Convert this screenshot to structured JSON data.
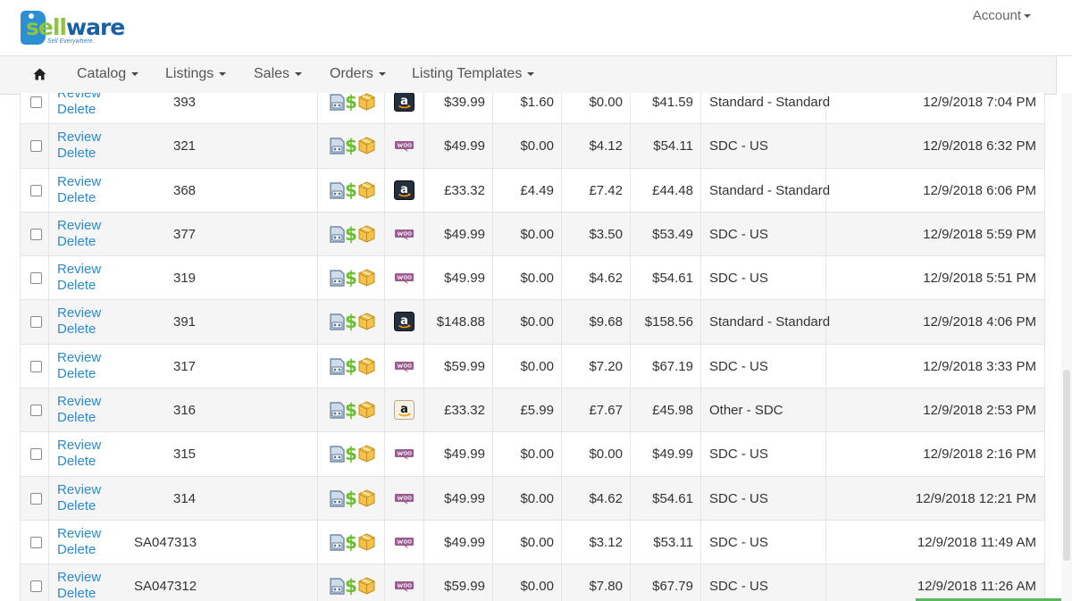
{
  "app": {
    "logo_text_a": "sell",
    "logo_text_b": "ware",
    "logo_tagline": "Sell Everywhere."
  },
  "header": {
    "account_label": "Account"
  },
  "nav": {
    "items": [
      {
        "label": "Catalog"
      },
      {
        "label": "Listings"
      },
      {
        "label": "Sales"
      },
      {
        "label": "Orders"
      },
      {
        "label": "Listing Templates"
      }
    ]
  },
  "row_actions": {
    "review_label": "Review",
    "delete_label": "Delete"
  },
  "orders": [
    {
      "sku": "393",
      "marketplace": "amazon-icon",
      "price": "$39.99",
      "fee": "$1.60",
      "tax": "$0.00",
      "total": "$41.59",
      "shipping": "Standard - Standard",
      "date": "12/9/2018 7:04 PM"
    },
    {
      "sku": "321",
      "marketplace": "woocommerce-icon",
      "price": "$49.99",
      "fee": "$0.00",
      "tax": "$4.12",
      "total": "$54.11",
      "shipping": "SDC - US",
      "date": "12/9/2018 6:32 PM"
    },
    {
      "sku": "368",
      "marketplace": "amazon-icon",
      "price": "£33.32",
      "fee": "£4.49",
      "tax": "£7.42",
      "total": "£44.48",
      "shipping": "Standard - Standard",
      "date": "12/9/2018 6:06 PM"
    },
    {
      "sku": "377",
      "marketplace": "woocommerce-icon",
      "price": "$49.99",
      "fee": "$0.00",
      "tax": "$3.50",
      "total": "$53.49",
      "shipping": "SDC - US",
      "date": "12/9/2018 5:59 PM"
    },
    {
      "sku": "319",
      "marketplace": "woocommerce-icon",
      "price": "$49.99",
      "fee": "$0.00",
      "tax": "$4.62",
      "total": "$54.61",
      "shipping": "SDC - US",
      "date": "12/9/2018 5:51 PM"
    },
    {
      "sku": "391",
      "marketplace": "amazon-icon",
      "price": "$148.88",
      "fee": "$0.00",
      "tax": "$9.68",
      "total": "$158.56",
      "shipping": "Standard - Standard",
      "date": "12/9/2018 4:06 PM"
    },
    {
      "sku": "317",
      "marketplace": "woocommerce-icon",
      "price": "$59.99",
      "fee": "$0.00",
      "tax": "$7.20",
      "total": "$67.19",
      "shipping": "SDC - US",
      "date": "12/9/2018 3:33 PM"
    },
    {
      "sku": "316",
      "marketplace": "amazon-light-icon",
      "price": "£33.32",
      "fee": "£5.99",
      "tax": "£7.67",
      "total": "£45.98",
      "shipping": "Other - SDC",
      "date": "12/9/2018 2:53 PM"
    },
    {
      "sku": "315",
      "marketplace": "woocommerce-icon",
      "price": "$49.99",
      "fee": "$0.00",
      "tax": "$0.00",
      "total": "$49.99",
      "shipping": "SDC - US",
      "date": "12/9/2018 2:16 PM"
    },
    {
      "sku": "314",
      "marketplace": "woocommerce-icon",
      "price": "$49.99",
      "fee": "$0.00",
      "tax": "$4.62",
      "total": "$54.61",
      "shipping": "SDC - US",
      "date": "12/9/2018 12:21 PM"
    },
    {
      "sku": "SA047313",
      "marketplace": "woocommerce-icon",
      "price": "$49.99",
      "fee": "$0.00",
      "tax": "$3.12",
      "total": "$53.11",
      "shipping": "SDC - US",
      "date": "12/9/2018 11:49 AM"
    },
    {
      "sku": "SA047312",
      "marketplace": "woocommerce-icon",
      "price": "$59.99",
      "fee": "$0.00",
      "tax": "$7.80",
      "total": "$67.79",
      "shipping": "SDC - US",
      "date": "12/9/2018 11:26 AM"
    }
  ],
  "icons": {
    "row_status": [
      "shipping-label-icon",
      "payment-dollar-icon",
      "package-box-icon"
    ],
    "nav_home": "home-icon"
  },
  "colors": {
    "link": "#2e8ac8",
    "dollar_green": "#6bbf2f",
    "box_yellow": "#f1c34a",
    "woo_purple": "#9b5c8f",
    "amazon_dark": "#232f3e",
    "amazon_orange": "#ff9900",
    "logo_blue": "#1d5fa3",
    "logo_green": "#8bc541"
  }
}
